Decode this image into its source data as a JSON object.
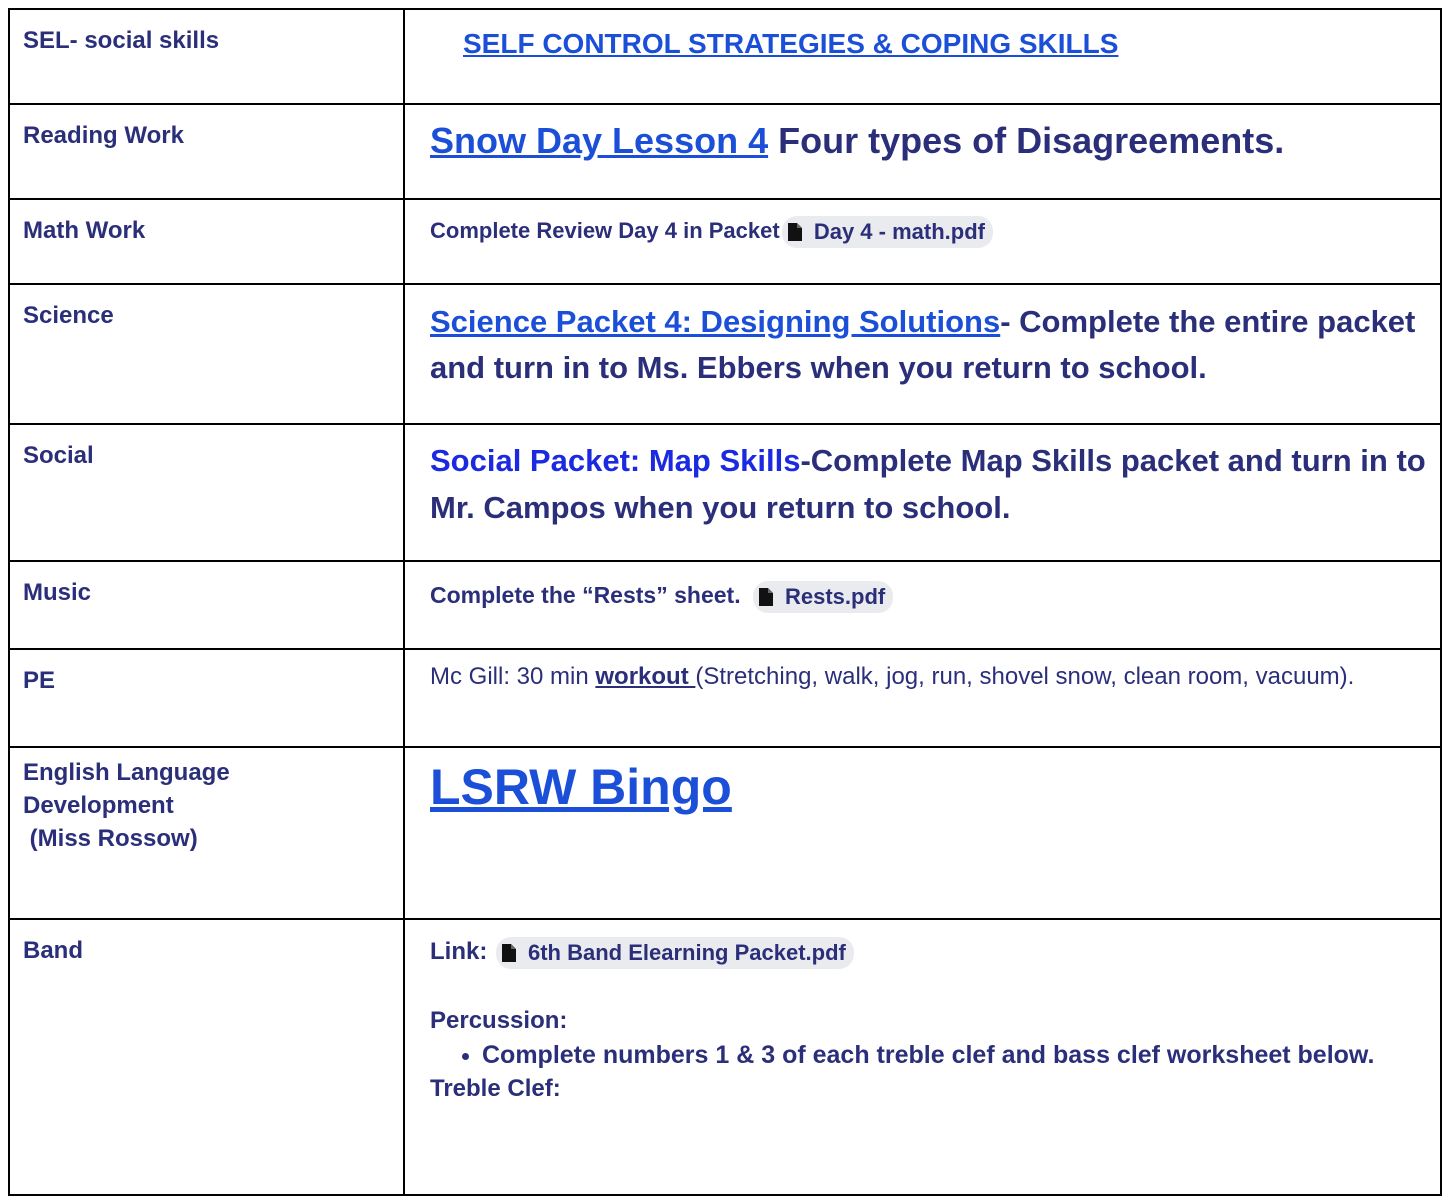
{
  "rows": {
    "sel": {
      "label": "SEL- social skills",
      "link": "SELF CONTROL STRATEGIES & COPING SKILLS"
    },
    "reading": {
      "label": "Reading Work",
      "link": "Snow Day Lesson 4",
      "text": " Four types of Disagreements."
    },
    "math": {
      "label": "Math Work",
      "text": "Complete Review Day 4 in Packet",
      "file": "Day 4 - math.pdf"
    },
    "science": {
      "label": "Science",
      "link": "Science Packet 4: Designing Solutions",
      "text": "- Complete the entire packet and turn in to Ms. Ebbers when you return to school."
    },
    "social": {
      "label": "Social",
      "link": "Social Packet: Map Skills",
      "text": "-Complete Map Skills packet and turn in to Mr. Campos when you return to school."
    },
    "music": {
      "label": "Music",
      "text": "Complete the “Rests” sheet.",
      "file": "Rests.pdf"
    },
    "pe": {
      "label": "PE",
      "text_before": "Mc Gill: 30 min ",
      "link": "workout ",
      "text_after": "(Stretching, walk, jog, run, shovel snow, clean room, vacuum)."
    },
    "eld": {
      "label_line1": "English Language",
      "label_line2": "Development",
      "label_line3": " (Miss Rossow)",
      "link": "LSRW Bingo"
    },
    "band": {
      "label": "Band",
      "link_prefix": "Link:",
      "file": "6th Band Elearning Packet.pdf",
      "percussion_heading": "Percussion:",
      "bullet": "Complete numbers 1 & 3 of each treble clef and bass clef worksheet below.",
      "treble_heading": "Treble Clef:"
    }
  }
}
